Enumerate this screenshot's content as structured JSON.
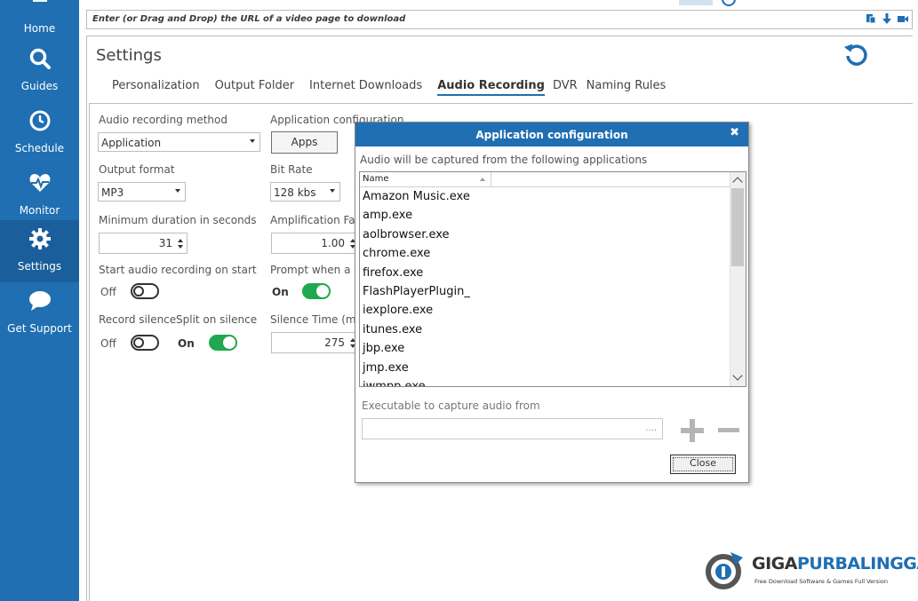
{
  "sidebar": {
    "items": [
      {
        "label": "Home",
        "icon": "home-icon"
      },
      {
        "label": "Guides",
        "icon": "search-icon"
      },
      {
        "label": "Schedule",
        "icon": "clock-icon"
      },
      {
        "label": "Monitor",
        "icon": "heart-pulse-icon"
      },
      {
        "label": "Settings",
        "icon": "gear-icon",
        "active": true
      },
      {
        "label": "Get Support",
        "icon": "chat-bubble-icon"
      }
    ]
  },
  "url_bar": {
    "placeholder": "Enter (or Drag and Drop) the URL of a video page to download",
    "icons": [
      "paste-icon",
      "download-arrow-icon",
      "video-camera-icon"
    ]
  },
  "page": {
    "title": "Settings",
    "reset_icon": "reset-icon"
  },
  "tabs": [
    {
      "label": "Personalization"
    },
    {
      "label": "Output Folder"
    },
    {
      "label": "Internet Downloads"
    },
    {
      "label": "Audio Recording",
      "active": true
    },
    {
      "label": "DVR"
    },
    {
      "label": "Naming Rules"
    }
  ],
  "audio": {
    "method_label": "Audio recording method",
    "method_value": "Application",
    "app_config_label": "Application configuration",
    "apps_button": "Apps",
    "output_format_label": "Output format",
    "output_format_value": "MP3",
    "bitrate_label": "Bit Rate",
    "bitrate_value": "128 kbs",
    "min_duration_label": "Minimum duration in seconds",
    "min_duration_value": "31",
    "amplification_label": "Amplification Factor",
    "amplification_value": "1.00",
    "start_on_start_label": "Start audio recording on start",
    "start_on_start_state": "Off",
    "prompt_label": "Prompt when a co",
    "prompt_state": "On",
    "record_silence_label": "Record silence",
    "record_silence_state": "Off",
    "split_silence_label": "Split on silence",
    "split_silence_state": "On",
    "silence_time_label": "Silence Time (ms)",
    "silence_time_value": "275"
  },
  "dialog": {
    "title": "Application configuration",
    "description": "Audio will be captured from the following applications",
    "column_name": "Name",
    "applications": [
      "Amazon Music.exe",
      "amp.exe",
      "aolbrowser.exe",
      "chrome.exe",
      "firefox.exe",
      "FlashPlayerPlugin_",
      "iexplore.exe",
      "itunes.exe",
      "jbp.exe",
      "jmp.exe",
      "iwmpp.exe"
    ],
    "executable_label": "Executable to capture audio from",
    "executable_browse": "....",
    "close_button": "Close",
    "colors": {
      "header": "#1f6fb2"
    }
  },
  "watermark": {
    "brand_part1": "GIGA",
    "brand_part2": "PURBALINGGA",
    "tagline": "Free Download Software & Games Full Version"
  },
  "colors": {
    "sidebar": "#1f6fb2",
    "toggle_on": "#1fa84f",
    "accent": "#1f6fb2"
  }
}
